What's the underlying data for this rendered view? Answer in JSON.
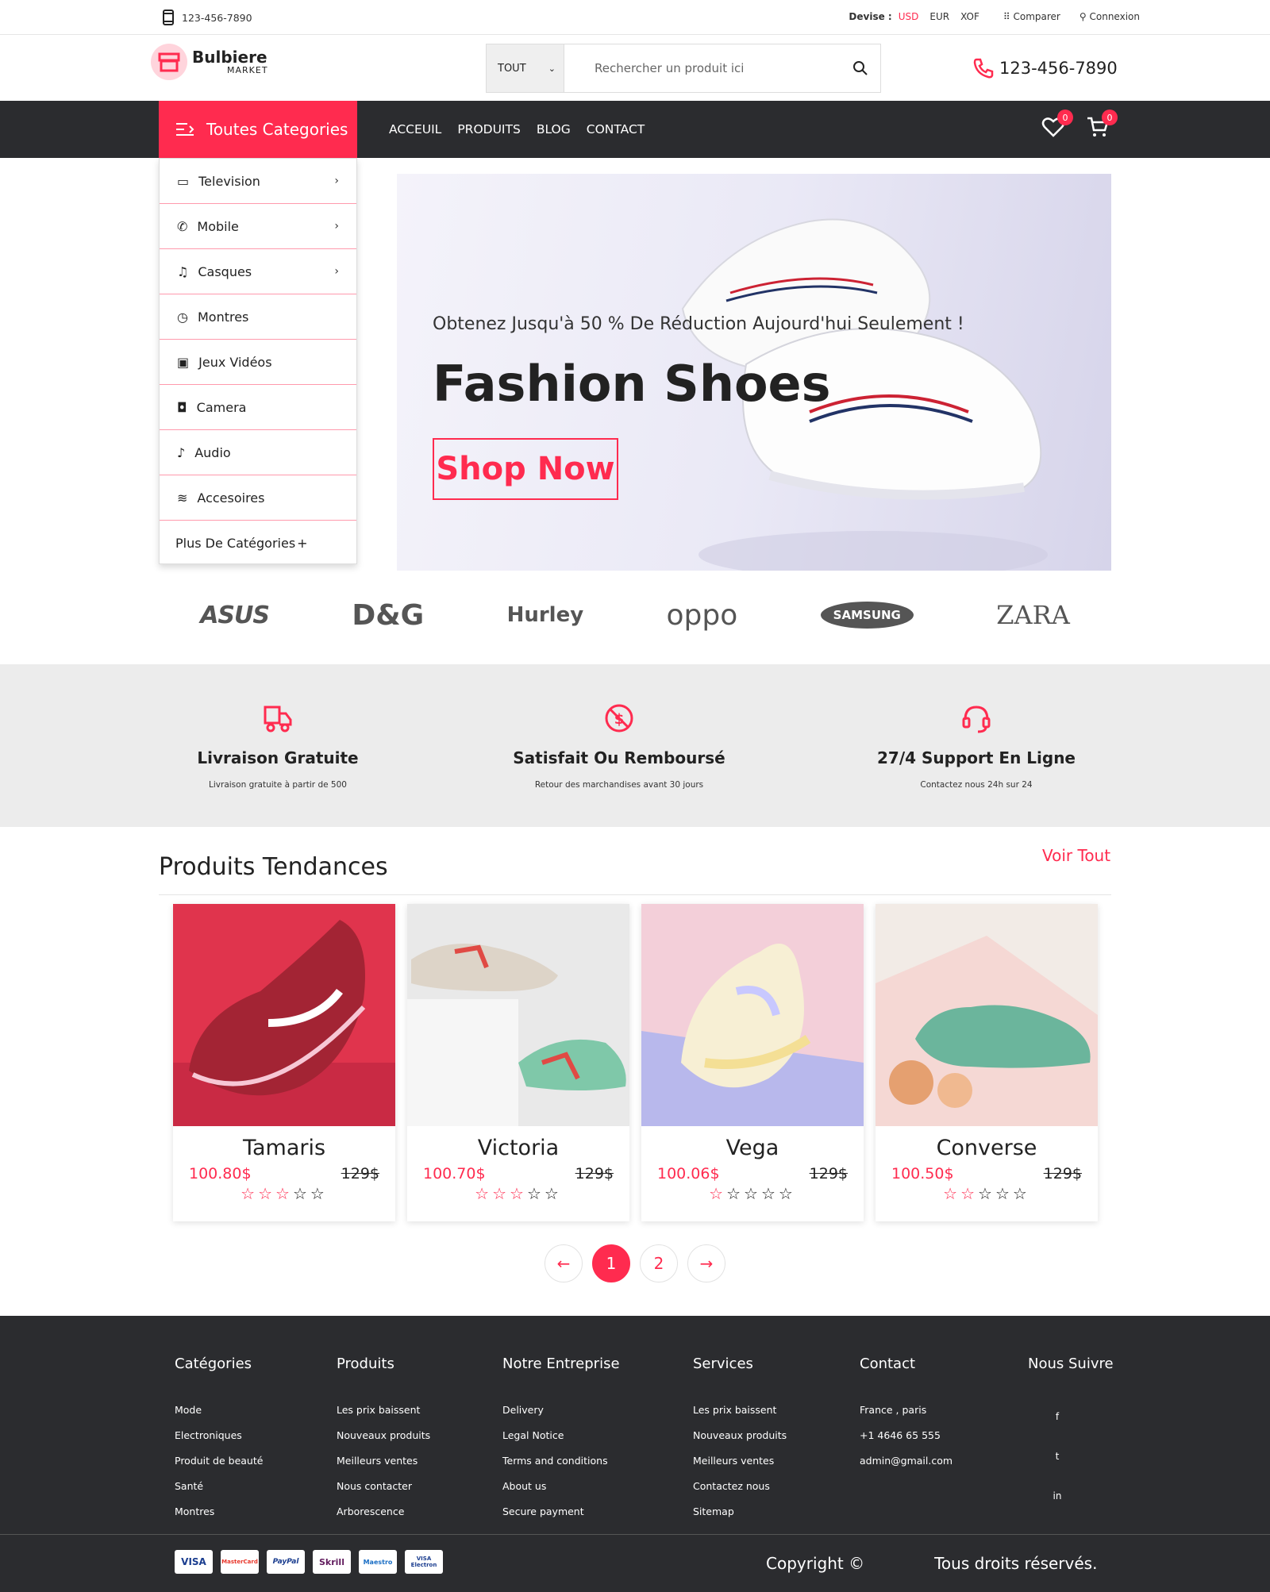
{
  "topbar": {
    "phone": "123-456-7890",
    "devise_label": "Devise :",
    "currencies": [
      "USD",
      "EUR",
      "XOF"
    ],
    "compare": "Comparer",
    "login": "Connexion"
  },
  "header": {
    "brand": "Bulbiere",
    "brand_sub": "MARKET",
    "search_category": "TOUT",
    "search_placeholder": "Rechercher un produit ici",
    "phone": "123-456-7890"
  },
  "nav": {
    "all_categories": "Toutes Categories",
    "menu": [
      "ACCEUIL",
      "PRODUITS",
      "BLOG",
      "CONTACT"
    ],
    "wishlist_count": "0",
    "cart_count": "0"
  },
  "sidebar": {
    "items": [
      {
        "label": "Television",
        "icon": "tv-icon",
        "has_sub": true
      },
      {
        "label": "Mobile",
        "icon": "phone-icon",
        "has_sub": true
      },
      {
        "label": "Casques",
        "icon": "headphones-icon",
        "has_sub": true
      },
      {
        "label": "Montres",
        "icon": "watch-icon",
        "has_sub": false
      },
      {
        "label": "Jeux Vidéos",
        "icon": "gamepad-icon",
        "has_sub": false
      },
      {
        "label": "Camera",
        "icon": "camera-icon",
        "has_sub": false
      },
      {
        "label": "Audio",
        "icon": "music-icon",
        "has_sub": false
      },
      {
        "label": "Accesoires",
        "icon": "layers-icon",
        "has_sub": false
      }
    ],
    "more": "Plus De Catégories"
  },
  "hero": {
    "subtitle": "Obtenez Jusqu'à 50 % De Réduction Aujourd'hui Seulement !",
    "title": "Fashion Shoes",
    "button": "Shop Now"
  },
  "brands": [
    "ASUS",
    "D&G",
    "Hurley",
    "oppo",
    "SAMSUNG",
    "ZARA"
  ],
  "features": [
    {
      "title": "Livraison Gratuite",
      "text": "Livraison gratuite à partir de 500",
      "icon": "truck-icon"
    },
    {
      "title": "Satisfait Ou Remboursé",
      "text": "Retour des marchandises avant 30 jours",
      "icon": "refund-icon"
    },
    {
      "title": "27/4 Support En Ligne",
      "text": "Contactez nous 24h sur 24",
      "icon": "headset-icon"
    }
  ],
  "trending": {
    "title": "Produits Tendances",
    "see_all": "Voir Tout",
    "products": [
      {
        "name": "Tamaris",
        "price": "100.80$",
        "old_price": "129$",
        "rating": 3
      },
      {
        "name": "Victoria",
        "price": "100.70$",
        "old_price": "129$",
        "rating": 3
      },
      {
        "name": "Vega",
        "price": "100.06$",
        "old_price": "129$",
        "rating": 1
      },
      {
        "name": "Converse",
        "price": "100.50$",
        "old_price": "129$",
        "rating": 2
      }
    ],
    "pages": [
      "1",
      "2"
    ]
  },
  "footer": {
    "columns": [
      {
        "title": "Catégories",
        "links": [
          "Mode",
          "Electroniques",
          "Produit de beauté",
          "Santé",
          "Montres"
        ]
      },
      {
        "title": "Produits",
        "links": [
          "Les prix baissent",
          "Nouveaux produits",
          "Meilleurs ventes",
          "Nous contacter",
          "Arborescence"
        ]
      },
      {
        "title": "Notre Entreprise",
        "links": [
          "Delivery",
          "Legal Notice",
          "Terms and conditions",
          "About us",
          "Secure payment"
        ]
      },
      {
        "title": "Services",
        "links": [
          "Les prix baissent",
          "Nouveaux produits",
          "Meilleurs ventes",
          "Contactez nous",
          "Sitemap"
        ]
      },
      {
        "title": "Contact",
        "links": [
          "France , paris",
          "+1 4646 65 555",
          "admin@gmail.com"
        ]
      }
    ],
    "follow": "Nous Suivre",
    "social": [
      "f",
      "t",
      "in"
    ],
    "payments": [
      "VISA",
      "MasterCard",
      "PayPal",
      "Skrill",
      "Maestro",
      "VISA Electron"
    ],
    "copyright": "Copyright ©",
    "rights": "Tous droits réservés."
  }
}
